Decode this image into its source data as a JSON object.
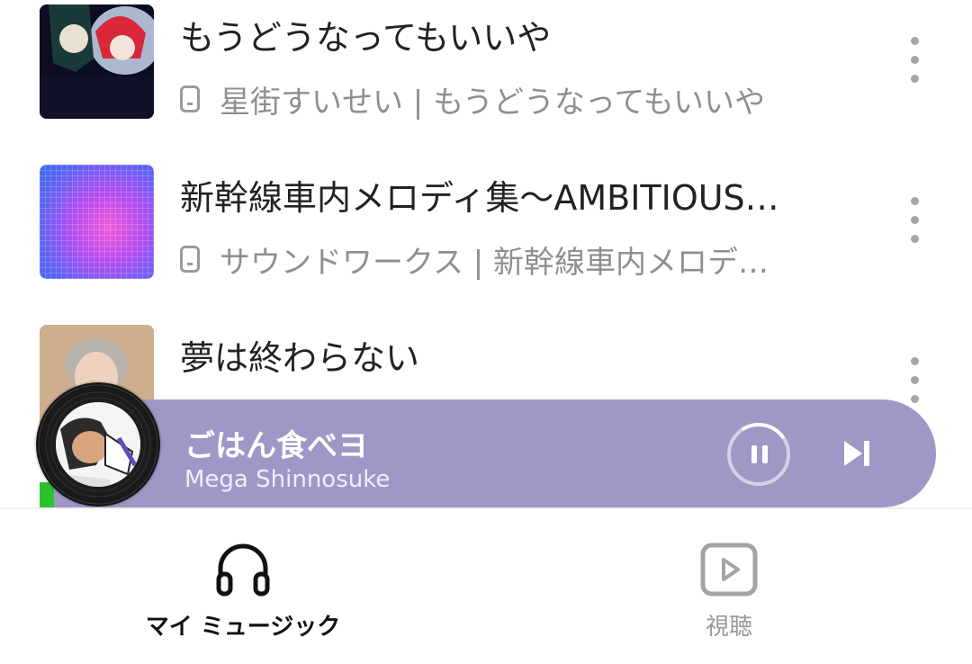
{
  "songs": [
    {
      "title": "もうどうなってもいいや",
      "artist_album": "星街すいせい | もうどうなってもいいや"
    },
    {
      "title": "新幹線車内メロディ集〜AMBITIOUS…",
      "artist_album": "サウンドワークス | 新幹線車内メロデ…"
    },
    {
      "title": "夢は終わらない",
      "artist_album": ""
    }
  ],
  "player": {
    "title": "ごはん食べヨ",
    "artist": "Mega Shinnosuke"
  },
  "nav": {
    "my_music": "マイ ミュージック",
    "watch": "視聴"
  },
  "colors": {
    "player_bg": "#a197c7",
    "accent_green": "#2dc22d"
  }
}
